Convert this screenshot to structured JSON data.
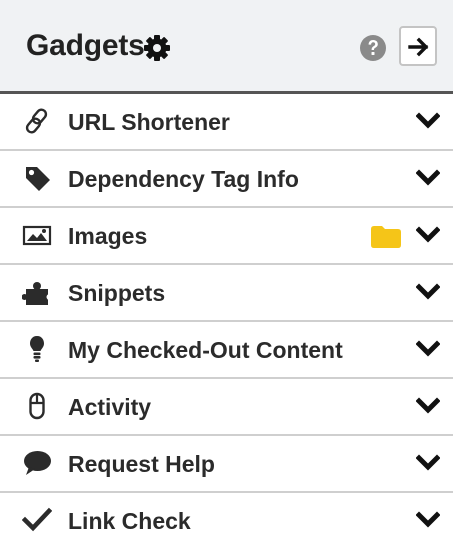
{
  "header": {
    "title": "Gadgets",
    "settings_icon": "gear-icon",
    "help_icon": "question-circle-icon",
    "collapse_icon": "arrow-right-icon"
  },
  "gadgets": [
    {
      "label": "URL Shortener",
      "icon": "link-icon"
    },
    {
      "label": "Dependency Tag Info",
      "icon": "tag-icon"
    },
    {
      "label": "Images",
      "icon": "image-icon",
      "extra_icon": "folder-icon"
    },
    {
      "label": "Snippets",
      "icon": "puzzle-icon"
    },
    {
      "label": "My Checked-Out Content",
      "icon": "lightbulb-icon"
    },
    {
      "label": "Activity",
      "icon": "mouse-icon"
    },
    {
      "label": "Request Help",
      "icon": "comment-icon"
    },
    {
      "label": "Link Check",
      "icon": "check-icon"
    }
  ],
  "colors": {
    "header_bg": "#f0f2f4",
    "text": "#2b2b2b",
    "folder": "#f5c518",
    "divider": "#cfcfcf"
  }
}
